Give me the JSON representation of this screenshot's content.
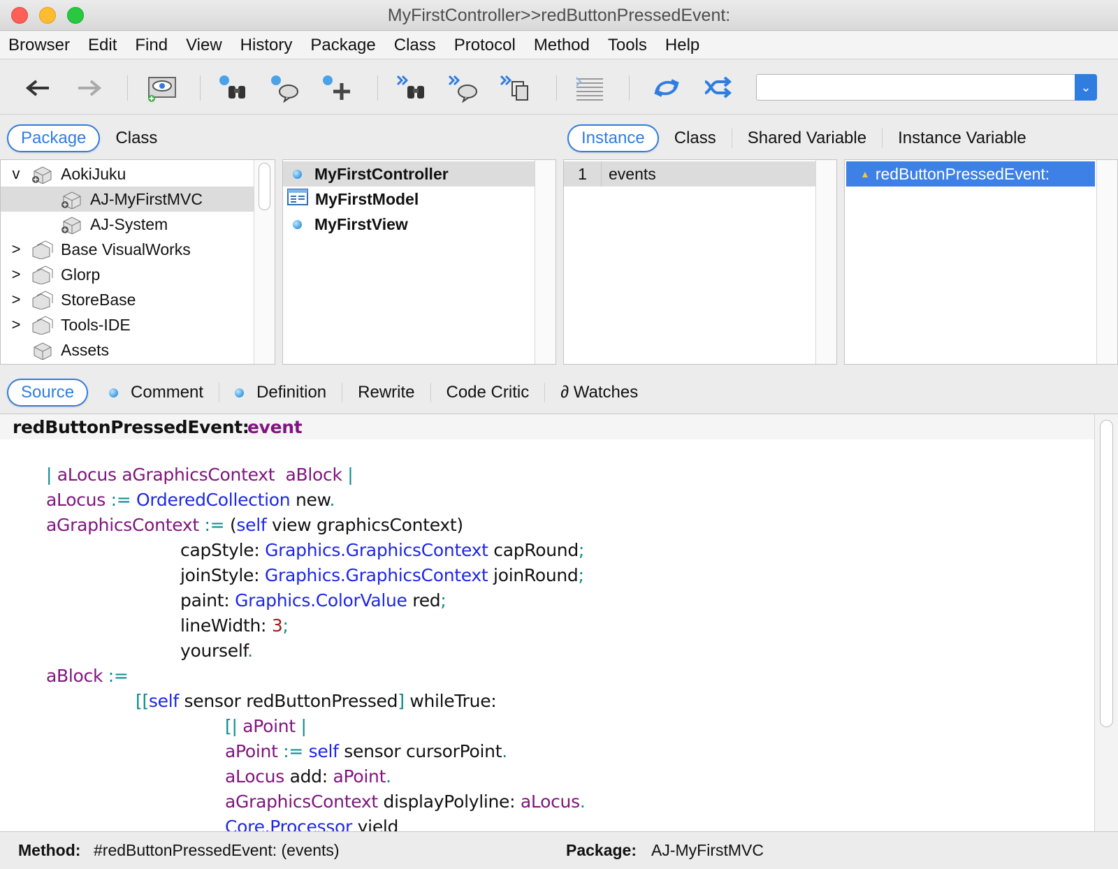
{
  "window": {
    "title": "MyFirstController>>redButtonPressedEvent:"
  },
  "menubar": [
    "Browser",
    "Edit",
    "Find",
    "View",
    "History",
    "Package",
    "Class",
    "Protocol",
    "Method",
    "Tools",
    "Help"
  ],
  "toolbar": {
    "search_value": "",
    "icons": [
      "back-arrow-icon",
      "forward-arrow-icon",
      "visual-browse-icon",
      "find-binoculars-icon",
      "find-message-icon",
      "add-icon",
      "senders-binoculars-icon",
      "senders-message-icon",
      "implementors-icon",
      "format-lines-icon",
      "sync-icon",
      "shuffle-icon"
    ]
  },
  "left_tabs": [
    "Package",
    "Class"
  ],
  "right_tabs": [
    "Instance",
    "Class",
    "Shared Variable",
    "Instance Variable"
  ],
  "packages": [
    {
      "label": "AokiJuku",
      "expander": "v",
      "indent": 0
    },
    {
      "label": "AJ-MyFirstMVC",
      "expander": "",
      "indent": 1,
      "selected": true
    },
    {
      "label": "AJ-System",
      "expander": "",
      "indent": 1
    },
    {
      "label": "Base VisualWorks",
      "expander": ">",
      "indent": 0
    },
    {
      "label": "Glorp",
      "expander": ">",
      "indent": 0
    },
    {
      "label": "StoreBase",
      "expander": ">",
      "indent": 0
    },
    {
      "label": "Tools-IDE",
      "expander": ">",
      "indent": 0
    },
    {
      "label": "Assets",
      "expander": "",
      "indent": 0
    }
  ],
  "classes": [
    "MyFirstController",
    "MyFirstModel",
    "MyFirstView"
  ],
  "protocols": [
    {
      "num": "1",
      "label": "events"
    }
  ],
  "methods": [
    "redButtonPressedEvent:"
  ],
  "code_tabs": [
    "Source",
    "Comment",
    "Definition",
    "Rewrite",
    "Code Critic",
    "∂ Watches"
  ],
  "source": {
    "header_selector": "redButtonPressedEvent:",
    "header_arg": "event",
    "lines": [
      [
        [
          "p",
          "| "
        ],
        [
          "v",
          "aLocus aGraphicsContext  aBlock "
        ],
        [
          "p",
          "|"
        ]
      ],
      [
        [
          "v",
          "aLocus "
        ],
        [
          "p",
          ":= "
        ],
        [
          "k",
          "OrderedCollection "
        ],
        [
          "",
          "new"
        ],
        [
          "p",
          "."
        ]
      ],
      [
        [
          "v",
          "aGraphicsContext "
        ],
        [
          "p",
          ":= "
        ],
        [
          "",
          "("
        ],
        [
          "k",
          "self "
        ],
        [
          "",
          "view graphicsContext)"
        ]
      ],
      [
        [
          "",
          "capStyle: "
        ],
        [
          "k",
          "Graphics.GraphicsContext "
        ],
        [
          "",
          "capRound"
        ],
        [
          "p",
          ";"
        ]
      ],
      [
        [
          "",
          "joinStyle: "
        ],
        [
          "k",
          "Graphics.GraphicsContext "
        ],
        [
          "",
          "joinRound"
        ],
        [
          "p",
          ";"
        ]
      ],
      [
        [
          "",
          "paint: "
        ],
        [
          "k",
          "Graphics.ColorValue "
        ],
        [
          "",
          "red"
        ],
        [
          "p",
          ";"
        ]
      ],
      [
        [
          "",
          "lineWidth: "
        ],
        [
          "n",
          "3"
        ],
        [
          "p",
          ";"
        ]
      ],
      [
        [
          "",
          "yourself"
        ],
        [
          "p",
          "."
        ]
      ],
      [
        [
          "v",
          "aBlock "
        ],
        [
          "p",
          ":="
        ]
      ],
      [
        [
          "p",
          "[["
        ],
        [
          "k",
          "self "
        ],
        [
          "",
          "sensor redButtonPressed"
        ],
        [
          "p",
          "] "
        ],
        [
          "",
          "whileTrue:"
        ]
      ],
      [
        [
          "p",
          "[| "
        ],
        [
          "v",
          "aPoint "
        ],
        [
          "p",
          "|"
        ]
      ],
      [
        [
          "v",
          "aPoint "
        ],
        [
          "p",
          ":= "
        ],
        [
          "k",
          "self "
        ],
        [
          "",
          "sensor cursorPoint"
        ],
        [
          "p",
          "."
        ]
      ],
      [
        [
          "v",
          "aLocus "
        ],
        [
          "",
          "add: "
        ],
        [
          "v",
          "aPoint"
        ],
        [
          "p",
          "."
        ]
      ],
      [
        [
          "v",
          "aGraphicsContext "
        ],
        [
          "",
          "displayPolyline: "
        ],
        [
          "v",
          "aLocus"
        ],
        [
          "p",
          "."
        ]
      ],
      [
        [
          "k",
          "Core.Processor "
        ],
        [
          "",
          "yield"
        ]
      ]
    ]
  },
  "status": {
    "method_label": "Method:",
    "method_value": "#redButtonPressedEvent: (events)",
    "package_label": "Package:",
    "package_value": "AJ-MyFirstMVC"
  }
}
